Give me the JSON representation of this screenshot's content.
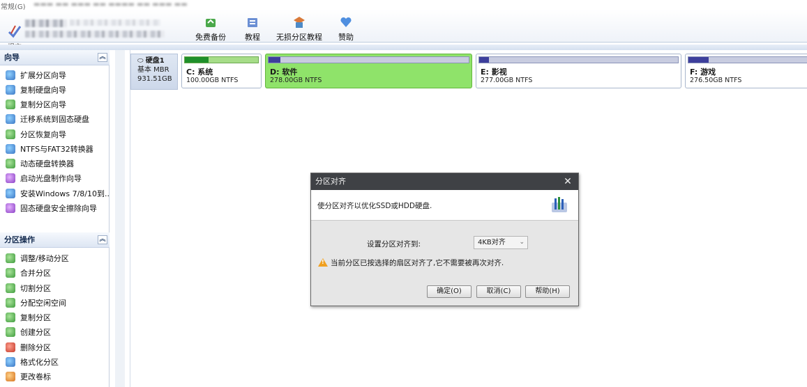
{
  "menubar": {
    "first_item": "常规(G)"
  },
  "toolbar": {
    "apply_label": "提交",
    "buttons": [
      {
        "label": "免费备份",
        "icon": "backup-icon"
      },
      {
        "label": "教程",
        "icon": "tutorial-icon"
      },
      {
        "label": "无损分区教程",
        "icon": "lossless-partition-icon"
      },
      {
        "label": "赞助",
        "icon": "heart-icon"
      }
    ]
  },
  "sidebar": {
    "wizard_title": "向导",
    "wizard_items": [
      "扩展分区向导",
      "复制硬盘向导",
      "复制分区向导",
      "迁移系统到固态硬盘",
      "分区恢复向导",
      "NTFS与FAT32转换器",
      "动态硬盘转换器",
      "启动光盘制作向导",
      "安装Windows 7/8/10到...",
      "固态硬盘安全擦除向导"
    ],
    "ops_title": "分区操作",
    "ops_items": [
      "调整/移动分区",
      "合并分区",
      "切割分区",
      "分配空闲空间",
      "复制分区",
      "创建分区",
      "删除分区",
      "格式化分区",
      "更改卷标"
    ]
  },
  "disk": {
    "name": "硬盘1",
    "type": "基本 MBR",
    "size": "931.51GB",
    "partitions": [
      {
        "label": "C: 系统",
        "size": "100.00GB NTFS",
        "used": 0.32,
        "selected": false
      },
      {
        "label": "D: 软件",
        "size": "278.00GB NTFS",
        "used": 0.06,
        "selected": true
      },
      {
        "label": "E: 影视",
        "size": "277.00GB NTFS",
        "used": 0.05,
        "selected": false
      },
      {
        "label": "F: 游戏",
        "size": "276.50GB NTFS",
        "used": 0.17,
        "selected": false
      }
    ]
  },
  "dialog": {
    "title": "分区对齐",
    "description": "使分区对齐以优化SSD或HDD硬盘.",
    "align_label": "设置分区对齐到:",
    "align_value": "4KB对齐",
    "warning": "当前分区已按选择的扇区对齐了,它不需要被再次对齐.",
    "ok": "确定(O)",
    "cancel": "取消(C)",
    "help": "帮助(H)"
  }
}
